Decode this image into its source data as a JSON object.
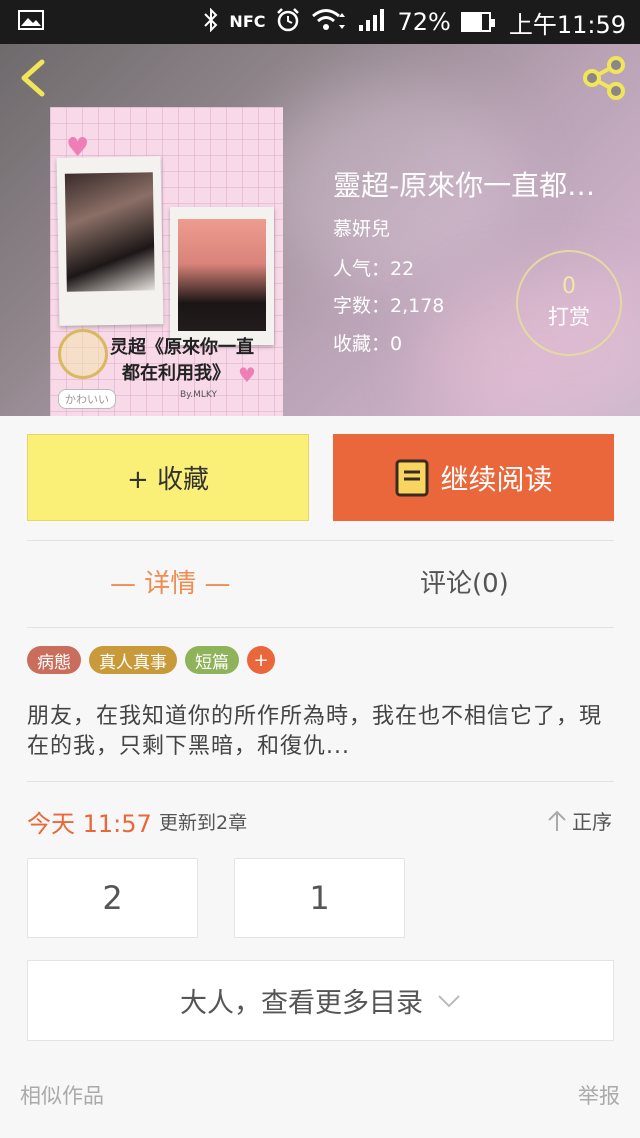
{
  "status_bar": {
    "battery": "72%",
    "time": "上午11:59",
    "icons": [
      "image-icon",
      "bluetooth-icon",
      "nfc-icon",
      "alarm-icon",
      "wifi-icon",
      "signal-icon",
      "battery-icon"
    ],
    "nfc_label": "NFC"
  },
  "header": {
    "back_icon": "chevron-left-icon",
    "share_icon": "share-icon",
    "cover": {
      "title_line1": "灵超《原來你一直",
      "title_line2": "都在利用我》",
      "signature": "By.MLKY",
      "tag": "かわいい"
    },
    "book": {
      "title": "靈超-原來你一直都…",
      "author": "慕妍兒",
      "popularity": "人气：22",
      "word_count": "字数：2,178",
      "favorites": "收藏：0"
    },
    "tip": {
      "count": "0",
      "label": "打赏"
    }
  },
  "actions": {
    "collect_label": "+ 收藏",
    "read_label": "继续阅读"
  },
  "tabs": {
    "detail": "— 详情 —",
    "comment": "评论(0)"
  },
  "tags": [
    {
      "label": "病態",
      "color": "#c96d5c"
    },
    {
      "label": "真人真事",
      "color": "#c99a3a"
    },
    {
      "label": "短篇",
      "color": "#8fb35a"
    },
    {
      "label": "+",
      "color": "#e9673a"
    }
  ],
  "description": "朋友，在我知道你的所作所為時，我在也不相信它了，現在的我，只剩下黑暗，和復仇...",
  "update": {
    "time": "今天 11:57",
    "text": "更新到2章",
    "sort_label": "正序"
  },
  "chapters": [
    "2",
    "1"
  ],
  "more_catalog": "大人，查看更多目录",
  "footer": {
    "similar": "相似作品",
    "report": "举报"
  },
  "colors": {
    "accent_orange": "#e9673a",
    "collect_yellow": "#faf078",
    "tab_active": "#f08c4f"
  }
}
